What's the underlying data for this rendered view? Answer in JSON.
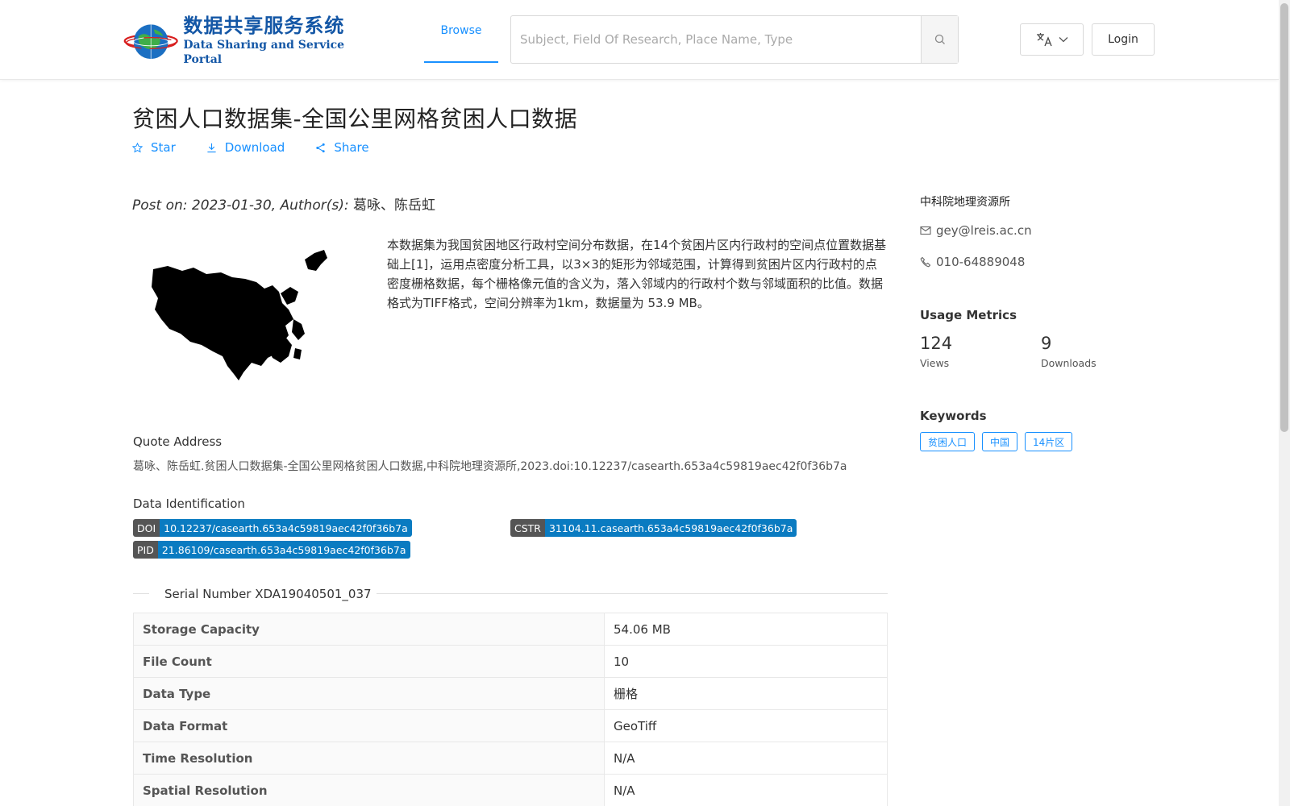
{
  "header": {
    "logo_cn": "数据共享服务系统",
    "logo_en": "Data Sharing and Service Portal",
    "nav_browse": "Browse",
    "search_placeholder": "Subject, Field Of Research, Place Name, Type",
    "login": "Login",
    "accent_color": "#1890ff"
  },
  "dataset": {
    "title": "贫困人口数据集-全国公里网格贫困人口数据",
    "actions": {
      "star": "Star",
      "download": "Download",
      "share": "Share"
    },
    "post_prefix": "Post on: 2023-01-30, Author(s): ",
    "authors": "葛咏、陈岳虹",
    "description": "本数据集为我国贫困地区行政村空间分布数据，在14个贫困片区内行政村的空间点位置数据基础上[1]，运用点密度分析工具，以3×3的矩形为邻域范围，计算得到贫困片区内行政村的点密度栅格数据，每个栅格像元值的含义为，落入邻域内的行政村个数与邻域面积的比值。数据格式为TIFF格式，空间分辨率为1km，数据量为 53.9 MB。",
    "quote_label": "Quote Address",
    "quote_text": "葛咏、陈岳虹.贫困人口数据集-全国公里网格贫困人口数据,中科院地理资源所,2023.doi:10.12237/casearth.653a4c59819aec42f0f36b7a",
    "ident_label": "Data Identification",
    "ids": {
      "doi_key": "DOI",
      "doi_val": "10.12237/casearth.653a4c59819aec42f0f36b7a",
      "cstr_key": "CSTR",
      "cstr_val": "31104.11.casearth.653a4c59819aec42f0f36b7a",
      "pid_key": "PID",
      "pid_val": "21.86109/casearth.653a4c59819aec42f0f36b7a"
    },
    "serial": "Serial Number XDA19040501_037",
    "info_rows": [
      {
        "key": "Storage Capacity",
        "value": "54.06 MB"
      },
      {
        "key": "File Count",
        "value": "10"
      },
      {
        "key": "Data Type",
        "value": "栅格"
      },
      {
        "key": "Data Format",
        "value": "GeoTiff"
      },
      {
        "key": "Time Resolution",
        "value": "N/A"
      },
      {
        "key": "Spatial Resolution",
        "value": "N/A"
      }
    ]
  },
  "sidebar": {
    "org": "中科院地理资源所",
    "email": "gey@lreis.ac.cn",
    "phone": "010-64889048",
    "usage_title": "Usage Metrics",
    "views_count": "124",
    "views_label": "Views",
    "downloads_count": "9",
    "downloads_label": "Downloads",
    "keywords_title": "Keywords",
    "keywords": [
      "贫困人口",
      "中国",
      "14片区"
    ]
  }
}
